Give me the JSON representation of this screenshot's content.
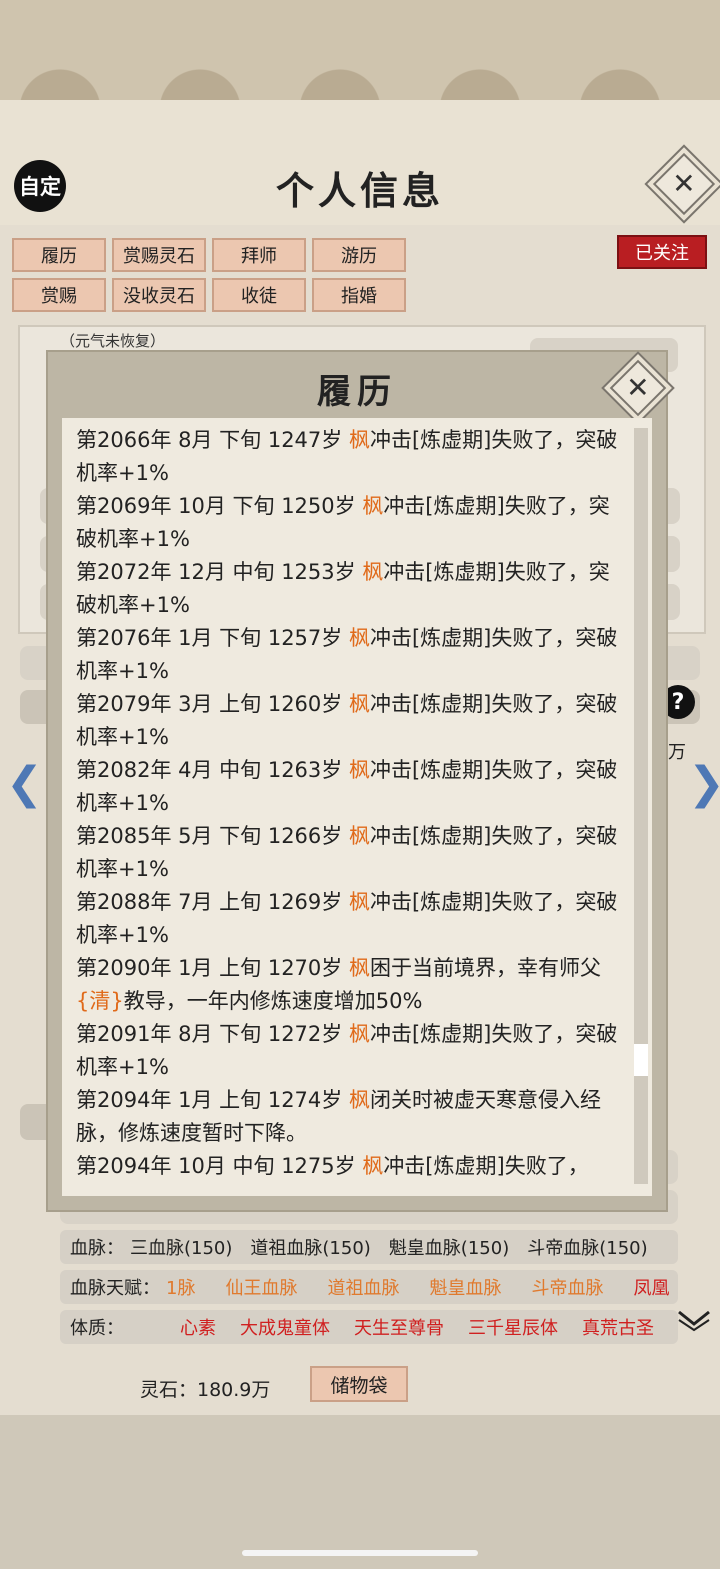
{
  "header": {
    "self_label": "自定",
    "title": "个人信息",
    "close_symbol": "✕"
  },
  "tabs": {
    "row1": [
      "履历",
      "赏赐灵石",
      "拜师",
      "游历"
    ],
    "row2": [
      "赏赐",
      "没收灵石",
      "收徒",
      "指婚"
    ],
    "followed": "已关注"
  },
  "background": {
    "yuanqi_status": "（元气未恢复）",
    "help_symbol": "?",
    "wan_label": "万",
    "left_arrow": "❮",
    "right_arrow": "❯",
    "bloodline_label": "血脉：",
    "bloodline_items": [
      "三血脉(150)",
      "道祖血脉(150)",
      "魁皇血脉(150)",
      "斗帝血脉(150)"
    ],
    "bloodline_talent_label": "血脉天赋：",
    "bloodline_talent_items": [
      "1脉",
      "仙王血脉",
      "道祖血脉",
      "魁皇血脉",
      "斗帝血脉",
      "凤凰"
    ],
    "physique_label": "体质：",
    "physique_items": [
      "心素",
      "大成鬼童体",
      "天生至尊骨",
      "三千星辰体",
      "真荒古圣"
    ],
    "spirit_stones": "灵石：180.9万",
    "bag_button": "储物袋"
  },
  "modal": {
    "title": "履历",
    "close_symbol": "✕",
    "entries": [
      {
        "prefix": "第2066年 8月 下旬 1247岁 ",
        "name": "枫",
        "text": "冲击[炼虚期]失败了，突破机率+1%"
      },
      {
        "prefix": "第2069年 10月 下旬 1250岁 ",
        "name": "枫",
        "text": "冲击[炼虚期]失败了，突破机率+1%"
      },
      {
        "prefix": "第2072年 12月 中旬 1253岁 ",
        "name": "枫",
        "text": "冲击[炼虚期]失败了，突破机率+1%"
      },
      {
        "prefix": "第2076年 1月 下旬 1257岁 ",
        "name": "枫",
        "text": "冲击[炼虚期]失败了，突破机率+1%"
      },
      {
        "prefix": "第2079年 3月 上旬 1260岁 ",
        "name": "枫",
        "text": "冲击[炼虚期]失败了，突破机率+1%"
      },
      {
        "prefix": "第2082年 4月 中旬 1263岁 ",
        "name": "枫",
        "text": "冲击[炼虚期]失败了，突破机率+1%"
      },
      {
        "prefix": "第2085年 5月 下旬 1266岁 ",
        "name": "枫",
        "text": "冲击[炼虚期]失败了，突破机率+1%"
      },
      {
        "prefix": "第2088年 7月 上旬 1269岁 ",
        "name": "枫",
        "text": "冲击[炼虚期]失败了，突破机率+1%"
      },
      {
        "prefix": "第2090年 1月 上旬 1270岁 ",
        "name": "枫",
        "text": "困于当前境界，幸有师父",
        "master": "{清}",
        "text2": "教导，一年内修炼速度增加50%"
      },
      {
        "prefix": "第2091年 8月 下旬 1272岁 ",
        "name": "枫",
        "text": "冲击[炼虚期]失败了，突破机率+1%"
      },
      {
        "prefix": "第2094年 1月 上旬 1274岁 ",
        "name": "枫",
        "text": "闭关时被虚天寒意侵入经脉，修炼速度暂时下降。"
      },
      {
        "prefix": "第2094年 10月 中旬 1275岁 ",
        "name": "枫",
        "text": "冲击[炼虚期]失败了，"
      }
    ]
  }
}
